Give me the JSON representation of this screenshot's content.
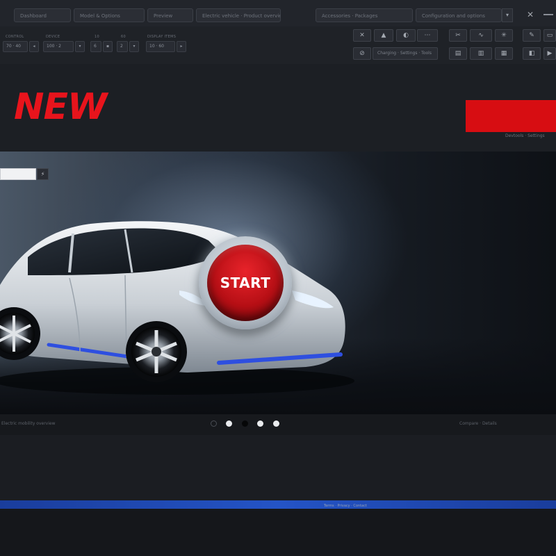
{
  "brand": {
    "logo_text": "NEW",
    "accent_color": "#e8141c",
    "red_block_caption": "Devtools · Settings"
  },
  "tabs": [
    {
      "label": "Dashboard"
    },
    {
      "label": "Model & Options"
    },
    {
      "label": "Preview"
    },
    {
      "label": "Electric vehicle · Product overview"
    },
    {
      "label": "Accessories · Packages"
    },
    {
      "label": "Configuration and options"
    }
  ],
  "ribbon": {
    "groups": [
      {
        "label": "CONTROL",
        "value": "70  ·  40"
      },
      {
        "label": "DEVICE",
        "value": "100 · 2"
      },
      {
        "label": "10",
        "value": "6"
      },
      {
        "label": "60",
        "value": "2"
      },
      {
        "label": "DISPLAY ITEMS",
        "value": "10 · 60"
      }
    ],
    "right_buttons": [
      {
        "icon": "✕"
      },
      {
        "icon": "▲"
      },
      {
        "icon": "◐"
      },
      {
        "icon": "⋯"
      },
      {
        "icon": "✂"
      },
      {
        "icon": "∿"
      },
      {
        "icon": "✳"
      },
      {
        "icon": "✎"
      },
      {
        "icon": "▭"
      },
      {
        "icon": "⊘"
      },
      {
        "label": "Charging · Settings · Tools"
      },
      {
        "icon": "▤"
      },
      {
        "icon": "▥"
      },
      {
        "icon": "▦"
      },
      {
        "icon": "◧"
      },
      {
        "icon": "▶"
      }
    ]
  },
  "hero": {
    "search_placeholder": "",
    "search_icon": "⚡",
    "start_label": "START"
  },
  "carousel": {
    "caption_left": "Electric mobility overview",
    "caption_right": "Compare · Details",
    "active_index": 0,
    "count": 5
  },
  "footer": {
    "text": "Terms · Privacy · Contact"
  }
}
